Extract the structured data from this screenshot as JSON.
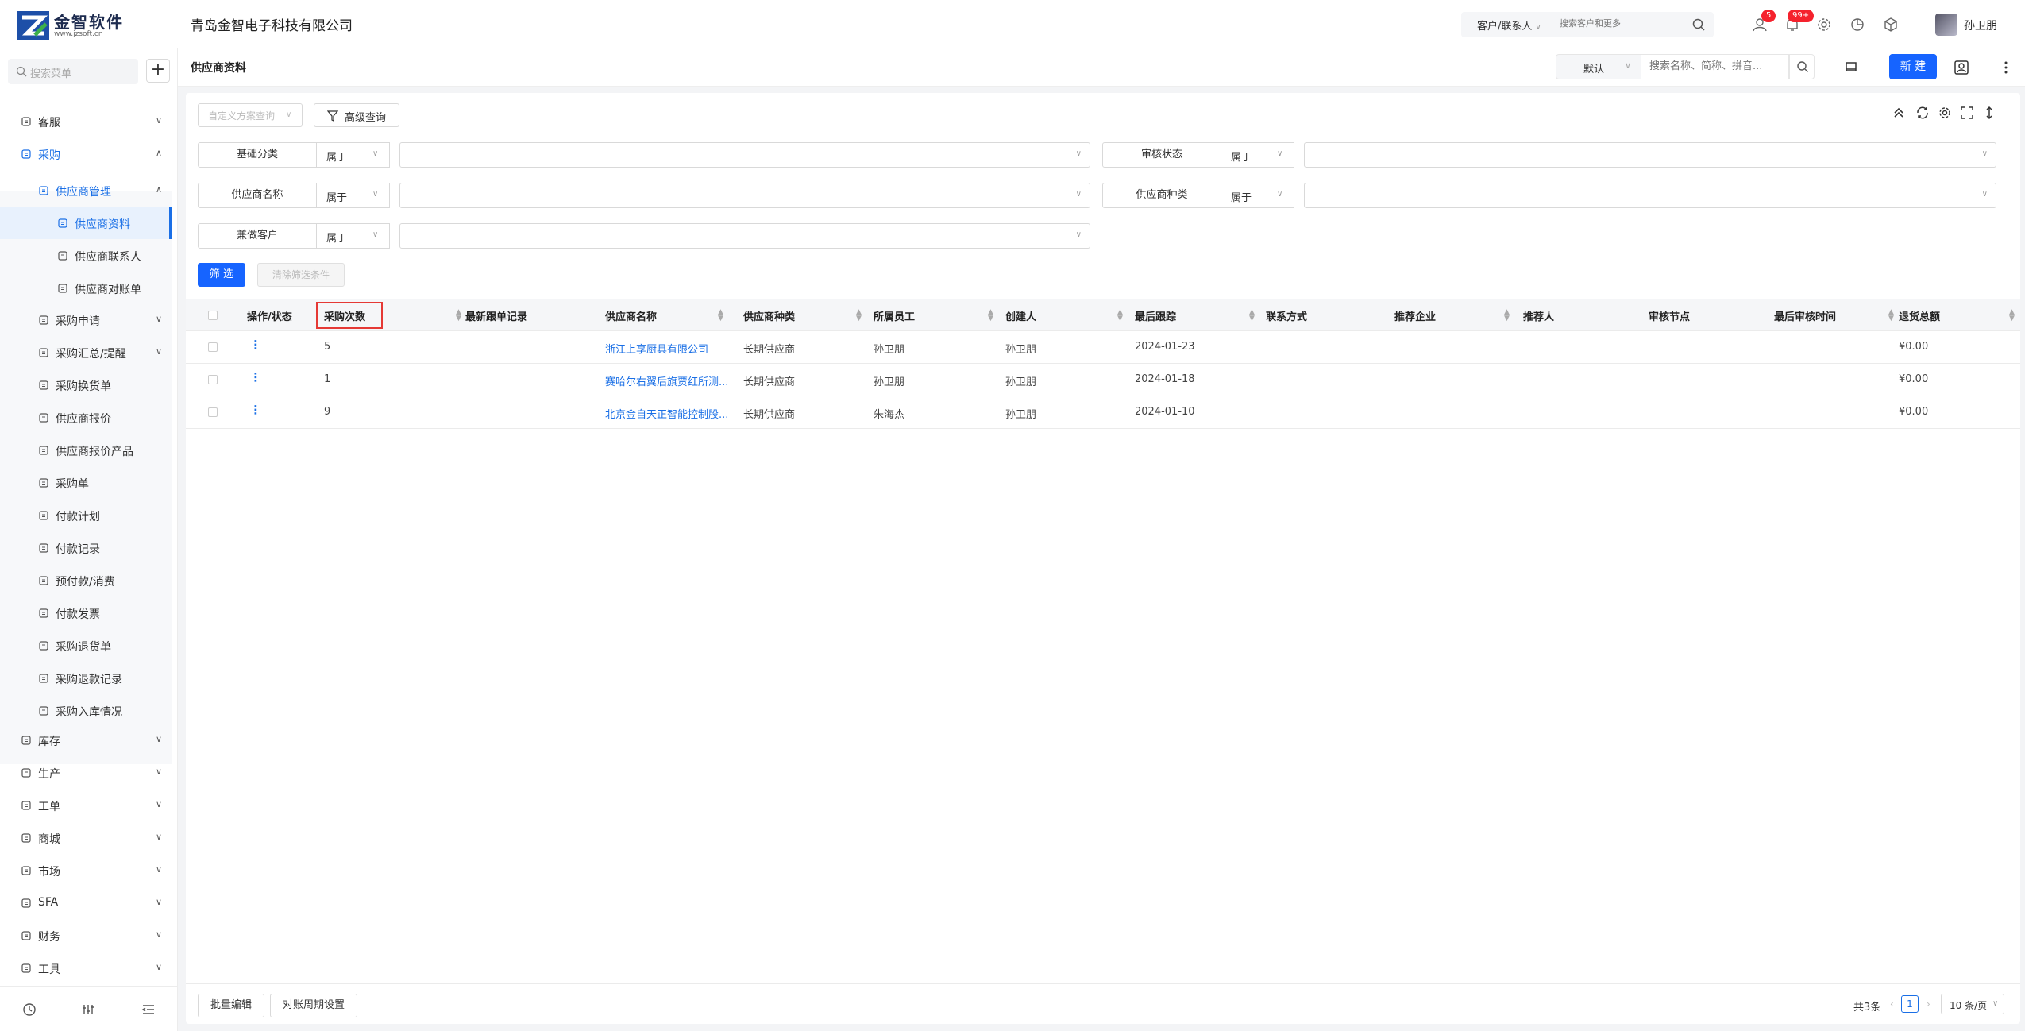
{
  "brand": {
    "name": "金智软件",
    "url": "www.jzsoft.cn"
  },
  "company": "青岛金智电子科技有限公司",
  "top_search": {
    "scope": "客户/联系人",
    "placeholder": "搜索客户和更多"
  },
  "notifications": {
    "messages_badge": "5",
    "bell_badge": "99+"
  },
  "user": {
    "name": "孙卫朋"
  },
  "sidebar": {
    "search_placeholder": "搜索菜单",
    "items": [
      {
        "label": "客服",
        "icon": "headset-icon"
      },
      {
        "label": "采购",
        "icon": "cart-icon"
      },
      {
        "label": "供应商管理",
        "icon": "supplier-icon"
      },
      {
        "label": "供应商资料",
        "icon": "profile-icon"
      },
      {
        "label": "供应商联系人",
        "icon": "contact-icon"
      },
      {
        "label": "供应商对账单",
        "icon": "statement-icon"
      },
      {
        "label": "采购申请",
        "icon": "request-icon"
      },
      {
        "label": "采购汇总/提醒",
        "icon": "summary-icon"
      },
      {
        "label": "采购换货单",
        "icon": "exchange-icon"
      },
      {
        "label": "供应商报价",
        "icon": "quote-icon"
      },
      {
        "label": "供应商报价产品",
        "icon": "quote-product-icon"
      },
      {
        "label": "采购单",
        "icon": "order-icon"
      },
      {
        "label": "付款计划",
        "icon": "plan-icon"
      },
      {
        "label": "付款记录",
        "icon": "payment-icon"
      },
      {
        "label": "预付款/消费",
        "icon": "prepay-icon"
      },
      {
        "label": "付款发票",
        "icon": "invoice-icon"
      },
      {
        "label": "采购退货单",
        "icon": "return-icon"
      },
      {
        "label": "采购退款记录",
        "icon": "refund-icon"
      },
      {
        "label": "采购入库情况",
        "icon": "inbound-icon"
      },
      {
        "label": "库存",
        "icon": "warehouse-icon"
      },
      {
        "label": "生产",
        "icon": "production-icon"
      },
      {
        "label": "工单",
        "icon": "workorder-icon"
      },
      {
        "label": "商城",
        "icon": "shop-icon"
      },
      {
        "label": "市场",
        "icon": "market-icon"
      },
      {
        "label": "SFA",
        "icon": "sfa-icon"
      },
      {
        "label": "财务",
        "icon": "finance-icon"
      },
      {
        "label": "工具",
        "icon": "tool-icon"
      }
    ]
  },
  "page": {
    "title": "供应商资料",
    "view": "默认",
    "search_placeholder": "搜索名称、简称、拼音...",
    "new_label": "新 建"
  },
  "filters": {
    "scheme_placeholder": "自定义方案查询",
    "advanced_label": "高级查询",
    "rows": [
      {
        "label": "基础分类",
        "op": "属于"
      },
      {
        "label": "审核状态",
        "op": "属于"
      },
      {
        "label": "供应商名称",
        "op": "属于"
      },
      {
        "label": "供应商种类",
        "op": "属于"
      },
      {
        "label": "兼做客户",
        "op": "属于"
      }
    ],
    "filter_label": "筛 选",
    "clear_label": "清除筛选条件"
  },
  "table": {
    "columns": [
      "操作/状态",
      "采购次数",
      "最新跟单记录",
      "供应商名称",
      "供应商种类",
      "所属员工",
      "创建人",
      "最后跟踪",
      "联系方式",
      "推荐企业",
      "推荐人",
      "审核节点",
      "最后审核时间",
      "退货总额"
    ],
    "rows": [
      {
        "count": "5",
        "name": "浙江上享厨具有限公司",
        "kind": "长期供应商",
        "staff": "孙卫朋",
        "creator": "孙卫朋",
        "last": "2024-01-23",
        "refund": "¥0.00"
      },
      {
        "count": "1",
        "name": "赛哈尔右翼后旗贾红所测...",
        "kind": "长期供应商",
        "staff": "孙卫朋",
        "creator": "孙卫朋",
        "last": "2024-01-18",
        "refund": "¥0.00"
      },
      {
        "count": "9",
        "name": "北京金自天正智能控制股...",
        "kind": "长期供应商",
        "staff": "朱海杰",
        "creator": "孙卫朋",
        "last": "2024-01-10",
        "refund": "¥0.00"
      }
    ]
  },
  "footer": {
    "batch_edit": "批量编辑",
    "period_setting": "对账周期设置",
    "total": "共3条",
    "page": "1",
    "page_size": "10 条/页"
  },
  "colors": {
    "accent": "#1664ff",
    "highlight": "#e53935"
  }
}
